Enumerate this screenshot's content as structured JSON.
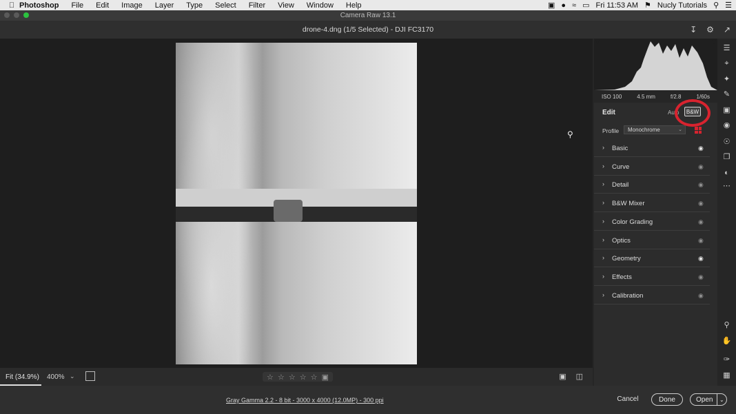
{
  "menubar": {
    "app": "Photoshop",
    "items": [
      "File",
      "Edit",
      "Image",
      "Layer",
      "Type",
      "Select",
      "Filter",
      "View",
      "Window",
      "Help"
    ],
    "clock": "Fri 11:53 AM",
    "user": "Nucly Tutorials"
  },
  "window": {
    "title": "Camera Raw 13.1"
  },
  "document": {
    "title": "drone-4.dng (1/5 Selected)  -  DJI FC3170"
  },
  "bottombar": {
    "fit": "Fit (34.9%)",
    "zoom": "400%"
  },
  "footer": {
    "info": "Gray Gamma 2.2 - 8 bit - 3000 x 4000 (12.0MP) - 300 ppi",
    "cancel": "Cancel",
    "done": "Done",
    "open": "Open"
  },
  "meta": {
    "iso": "ISO 100",
    "focal": "4.5 mm",
    "aperture": "f/2.8",
    "shutter": "1/60s"
  },
  "edit": {
    "title": "Edit",
    "auto": "Auto",
    "bw": "B&W",
    "profile_label": "Profile",
    "profile_value": "Monochrome"
  },
  "sections": [
    {
      "label": "Basic",
      "eye_on": true
    },
    {
      "label": "Curve",
      "eye_on": false
    },
    {
      "label": "Detail",
      "eye_on": false
    },
    {
      "label": "B&W Mixer",
      "eye_on": false
    },
    {
      "label": "Color Grading",
      "eye_on": false
    },
    {
      "label": "Optics",
      "eye_on": false
    },
    {
      "label": "Geometry",
      "eye_on": true
    },
    {
      "label": "Effects",
      "eye_on": false
    },
    {
      "label": "Calibration",
      "eye_on": false
    }
  ],
  "colors": {
    "accent_red": "#d8232f"
  }
}
